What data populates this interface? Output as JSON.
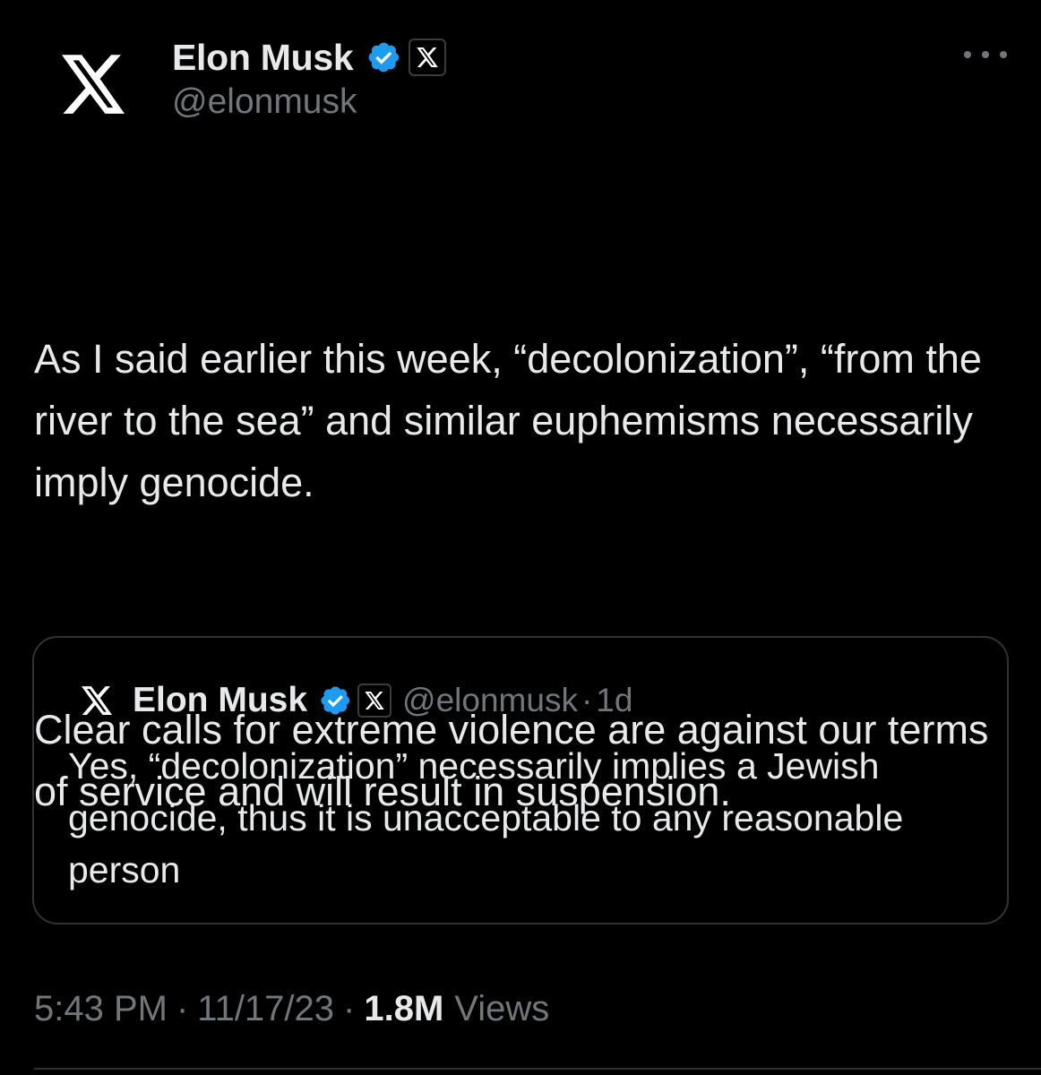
{
  "colors": {
    "background": "#000000",
    "text_primary": "#e7e9ea",
    "text_secondary": "#71767b",
    "verified_blue": "#1d9bf0",
    "border": "#2f3336"
  },
  "author": {
    "avatar_icon": "x-logo-icon",
    "display_name": "Elon Musk",
    "verified_icon": "verified-badge-icon",
    "affiliation_icon": "x-logo-icon",
    "handle": "@elonmusk"
  },
  "more_icon": "more-dots-icon",
  "tweet": {
    "paragraphs": [
      "As I said earlier this week, “decolonization”, “from the river to the sea” and similar euphemisms necessarily imply genocide.",
      "Clear calls for extreme violence are against our terms of service and will result in suspension."
    ]
  },
  "quote": {
    "display_name": "Elon Musk",
    "handle": "@elonmusk",
    "separator": "·",
    "time": "1d",
    "text": "Yes, “decolonization” necessarily implies a Jewish genocide, thus it is unacceptable to any reasonable person"
  },
  "meta": {
    "time": "5:43 PM",
    "separator": "·",
    "date": "11/17/23",
    "views_count": "1.8M",
    "views_label": "Views"
  }
}
